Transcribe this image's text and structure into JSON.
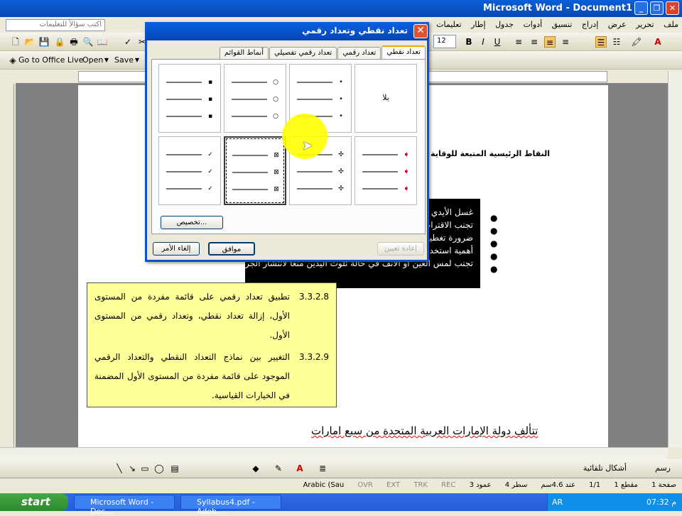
{
  "window": {
    "title": "Microsoft Word - Document1"
  },
  "menu": {
    "items": [
      "ملف",
      "تحرير",
      "عرض",
      "إدراج",
      "تنسيق",
      "أدوات",
      "جدول",
      "إطار",
      "تعليمات"
    ]
  },
  "help_box": {
    "placeholder": "اكتب سؤالاً للتعليمات"
  },
  "toolbar2": {
    "goto_office_live": "Go to Office Live",
    "open": "Open",
    "save": "Save"
  },
  "font_size": "12",
  "document": {
    "heading": "النقاط الرئيسية المتبعة للوقاية",
    "bullets": [
      "غسل الأيدي بالـ",
      "تجنب الاقتراب",
      "ضرورة تغطية",
      "أهمية استخدام",
      "تجنب لمس العين أو الأنف في حالة تلوث اليدين منعا لانتشار الجراثيم."
    ],
    "yellow": [
      {
        "num": "3.3.2.8",
        "text": "تطبيق تعداد رقمي على قائمة مفردة من المستوى الأول، إزالة تعداد نقطي، وتعداد رقمي من المستوى الأول."
      },
      {
        "num": "3.3.2.9",
        "text": "التغيير بين نماذج التعداد النقطي والتعداد الرقمي الموجود على قائمة مفردة من المستوى الأول المضمنة في الخيارات القياسية."
      }
    ],
    "footer_sentence": "تتألف دولة الإمارات العربية المتحدة من سبع امارات"
  },
  "dialog": {
    "title": "تعداد نقطي وتعداد رقمي",
    "tabs": [
      "تعداد نقطي",
      "تعداد رقمي",
      "تعداد رقمي تفصيلي",
      "أنماط القوائم"
    ],
    "none_label": "بلا",
    "customize": "تخصيص...",
    "reset": "إعادة تعيين",
    "ok": "موافق",
    "cancel": "إلغاء الأمر",
    "bullet_glyphs": {
      "row1": [
        "•",
        "○",
        "▪"
      ],
      "row2": [
        "✓",
        "⊠",
        "✣"
      ]
    }
  },
  "drawing": {
    "autoshapes": "أشكال تلقائية",
    "draw": "رسم"
  },
  "status": {
    "page": "صفحة 1",
    "section": "مقطع 1",
    "pages": "1/1",
    "at": "عند 4.6سم",
    "line": "سطر 4",
    "col": "عمود 3",
    "flags": [
      "REC",
      "TRK",
      "EXT",
      "OVR"
    ],
    "lang": "Arabic (Sau"
  },
  "taskbar": {
    "start": "start",
    "items": [
      "Microsoft Word - Doc...",
      "Syllabus4.pdf - Adob..."
    ],
    "lang": "AR",
    "time": "07:32 م"
  },
  "colors": {
    "title_blue": "#0a5fd8",
    "highlight": "#ffff99",
    "tab_accent": "#f6a500"
  }
}
